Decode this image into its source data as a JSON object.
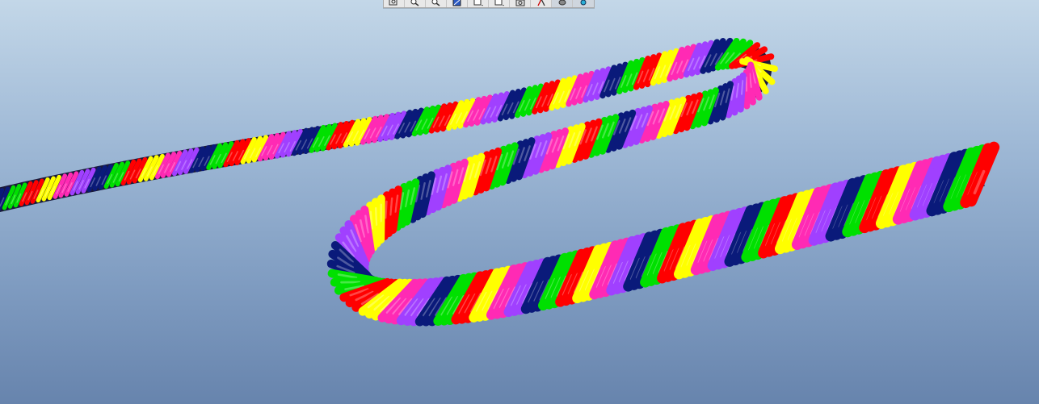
{
  "window": {
    "title": "",
    "view_background": {
      "top": "#c3d7e8",
      "bottom": "#6784ad"
    }
  },
  "toolbar": {
    "buttons": [
      {
        "icon": "zoom-window-icon"
      },
      {
        "icon": "zoom-in-icon"
      },
      {
        "icon": "zoom-out-icon"
      },
      {
        "icon": "repaint-icon"
      },
      {
        "icon": "display-style-icon",
        "has_dropdown": true
      },
      {
        "icon": "saved-views-icon",
        "has_dropdown": true
      },
      {
        "icon": "view-manager-icon"
      },
      {
        "icon": "datum-display-icon"
      },
      {
        "icon": "layers-icon",
        "pressed": true
      },
      {
        "icon": "appearance-icon",
        "pressed": true
      }
    ]
  },
  "model": {
    "name": "twisted-rope",
    "strand_colors": [
      "#0a1a7a",
      "#00e000",
      "#ff0000",
      "#ffff00",
      "#ff2ab4",
      "#a040ff"
    ]
  }
}
